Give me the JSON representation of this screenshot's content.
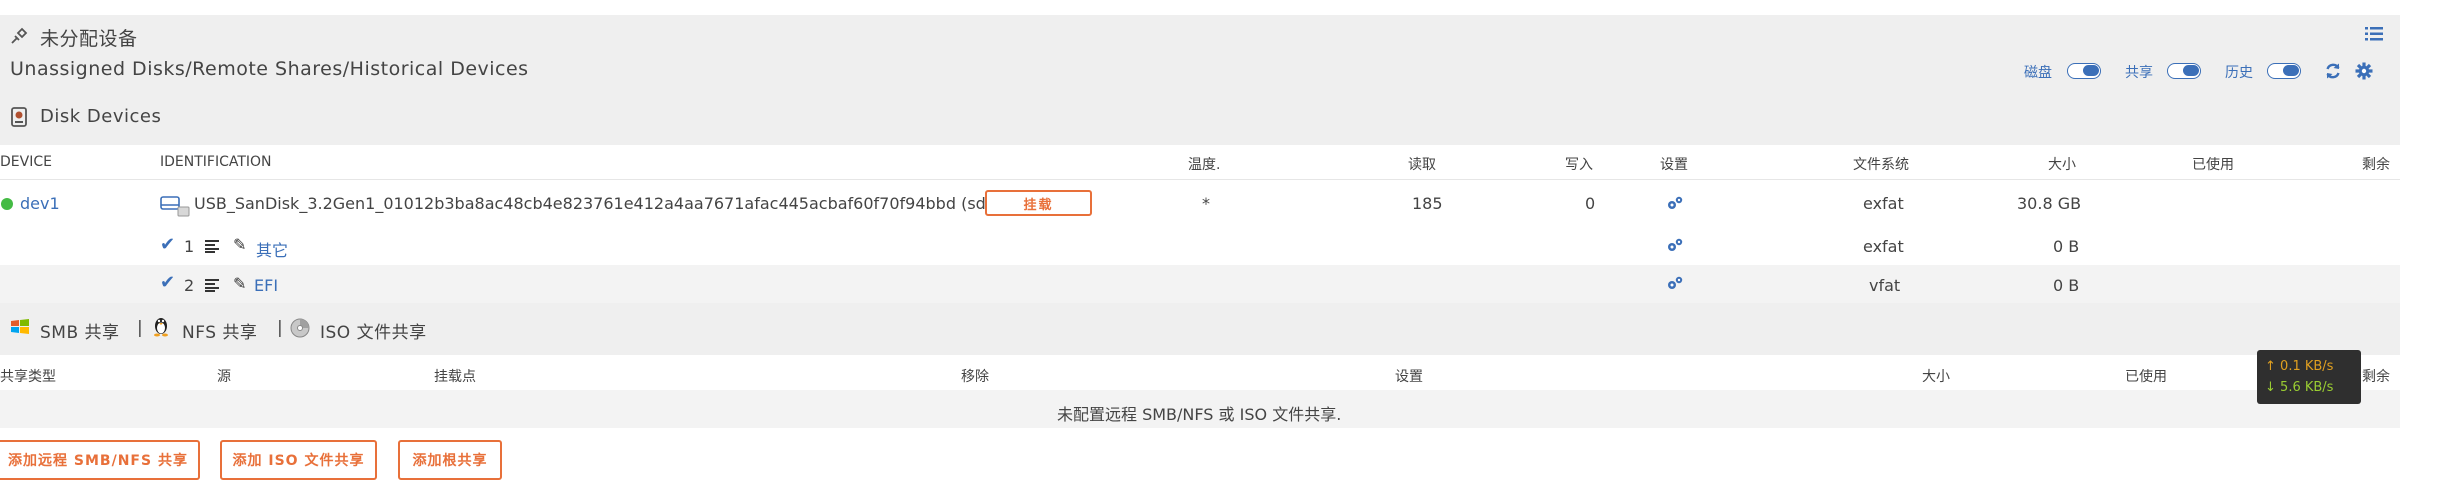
{
  "header": {
    "title_cn": "未分配设备",
    "subtitle": "Unassigned Disks/Remote Shares/Historical Devices",
    "toggles": [
      {
        "label": "磁盘"
      },
      {
        "label": "共享"
      },
      {
        "label": "历史"
      }
    ]
  },
  "disk_section": {
    "title": "Disk Devices",
    "columns": [
      "DEVICE",
      "IDENTIFICATION",
      "温度.",
      "读取",
      "写入",
      "设置",
      "文件系统",
      "大小",
      "已使用",
      "剩余"
    ],
    "device": {
      "name": "dev1",
      "identification": "USB_SanDisk_3.2Gen1_01012b3ba8ac48cb4e823761e412a4aa7671afac445acbaf60f70f94bbd (sda)",
      "mount_label": "挂载",
      "temp": "*",
      "reads": "185",
      "writes": "0",
      "filesystem": "exfat",
      "size": "30.8 GB"
    },
    "partitions": [
      {
        "num": "1",
        "label": "其它",
        "filesystem": "exfat",
        "size": "0 B"
      },
      {
        "num": "2",
        "label": "EFI",
        "filesystem": "vfat",
        "size": "0 B"
      }
    ]
  },
  "share_section": {
    "smb": "SMB 共享",
    "nfs": "NFS 共享",
    "iso": "ISO 文件共享",
    "sep": "|",
    "columns": [
      "共享类型",
      "源",
      "挂载点",
      "移除",
      "设置",
      "大小",
      "已使用",
      "剩余"
    ],
    "empty_message": "未配置远程 SMB/NFS 或 ISO 文件共享.",
    "buttons": [
      "添加远程 SMB/NFS 共享",
      "添加 ISO 文件共享",
      "添加根共享"
    ]
  },
  "speed": {
    "up": "0.1 KB/s",
    "down": "5.6 KB/s"
  },
  "colors": {
    "accent": "#3b6fb8",
    "orange": "#e8703a",
    "status_green": "#44bb44"
  }
}
